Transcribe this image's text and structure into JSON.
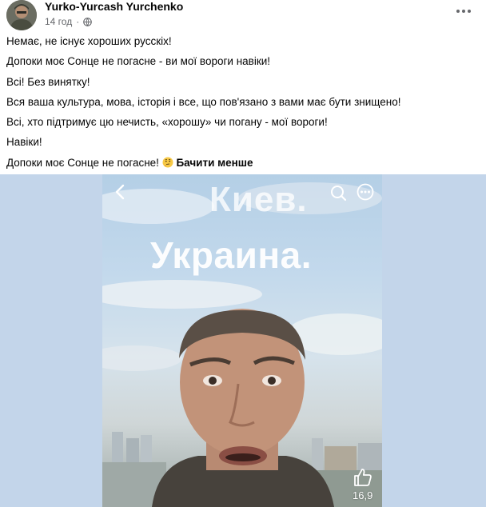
{
  "post": {
    "author": "Yurko-Yurcash Yurchenko",
    "time": "14 год",
    "dot": "·",
    "lines": [
      "Немає, не існує хороших русскіх!",
      "Допоки моє Сонце не погасне - ви мої  вороги навіки!",
      "Всі! Без винятку!",
      "Вся ваша культура, мова, історія і все, що пов'язано з вами має бути знищено!",
      "Всі, хто підтримує цю нечисть, «хорошу» чи погану - мої вороги!",
      "Навіки!",
      "Допоки моє Сонце не погасне!"
    ],
    "see_less": "Бачити менше",
    "emoji": "thinking-face"
  },
  "video": {
    "overlay_city": "Киев.",
    "overlay_country": "Украина.",
    "like_count": "16,9",
    "icons": [
      "back-arrow-icon",
      "search-icon",
      "more-options-icon",
      "thumbs-up-icon"
    ]
  },
  "colors": {
    "background": "#ffffff",
    "media_background": "#c3d5ea",
    "secondary_text": "#65676b"
  }
}
